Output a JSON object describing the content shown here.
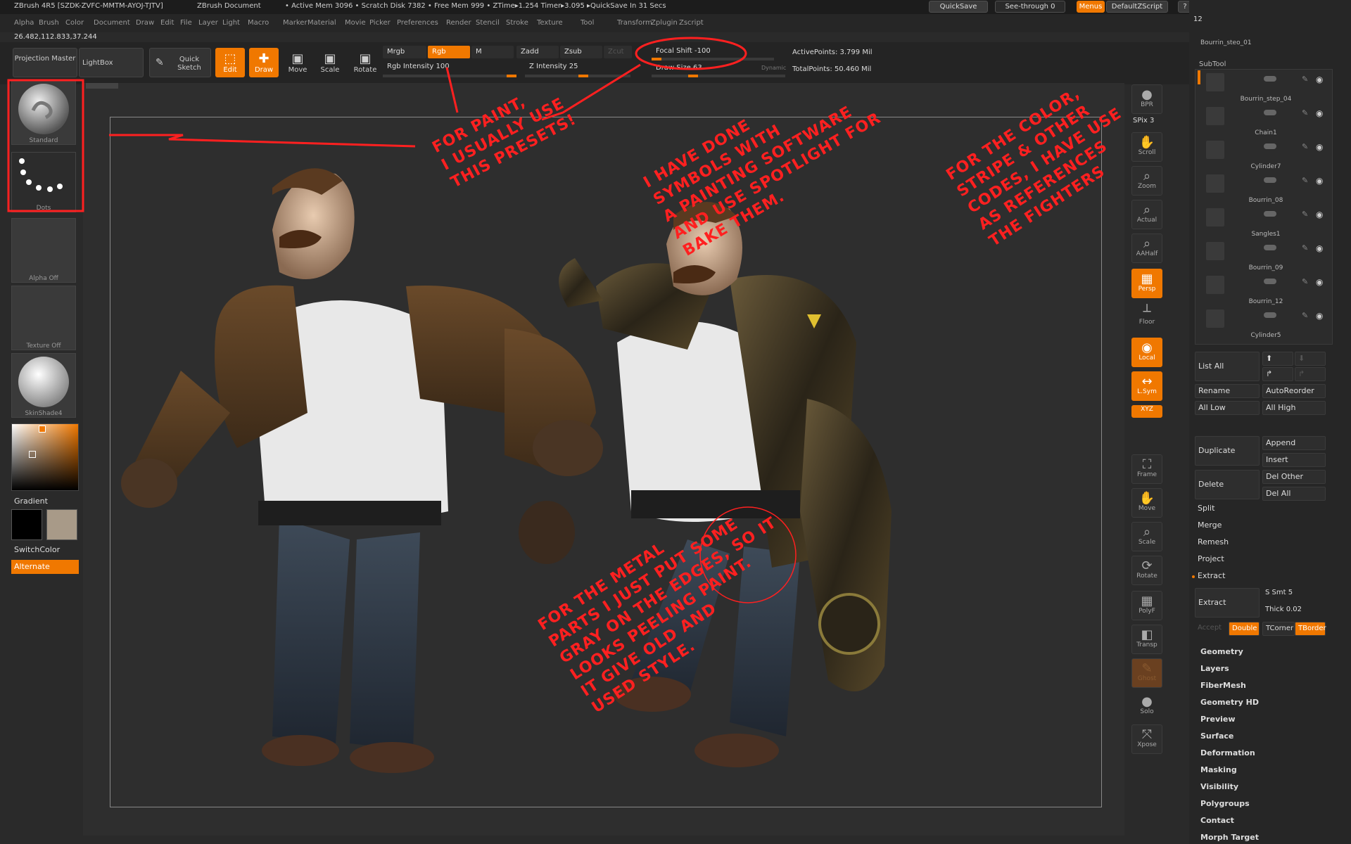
{
  "titlebar": {
    "app": "ZBrush 4R5 [SZDK-ZVFC-MMTM-AYOJ-TJTV]",
    "doc": "ZBrush Document",
    "stats": "• Active Mem 3096 • Scratch Disk 7382 • Free Mem 999 • ZTime▸1.254 Timer▸3.095 ▸QuickSave In 31 Secs",
    "quicksave": "QuickSave",
    "seethrough": "See-through 0",
    "menus": "Menus",
    "script": "DefaultZScript"
  },
  "menubar": [
    "Alpha",
    "Brush",
    "Color",
    "Document",
    "Draw",
    "Edit",
    "File",
    "Layer",
    "Light",
    "Macro",
    "Marker",
    "Material",
    "Movie",
    "Picker",
    "Preferences",
    "Render",
    "Stencil",
    "Stroke",
    "Texture",
    "Tool",
    "Transform",
    "Zplugin",
    "Zscript"
  ],
  "coords": "26.482,112.833,37.244",
  "toolbar": {
    "projection_master": "Projection Master",
    "lightbox": "LightBox",
    "quick_sketch": "Quick Sketch",
    "edit": "Edit",
    "draw": "Draw",
    "move": "Move",
    "scale": "Scale",
    "rotate": "Rotate",
    "mrgb": "Mrgb",
    "rgb": "Rgb",
    "m": "M",
    "zadd": "Zadd",
    "zsub": "Zsub",
    "zcut": "Zcut",
    "rgb_intensity": "Rgb Intensity 100",
    "z_intensity": "Z Intensity 25",
    "focal_shift": "Focal Shift -100",
    "draw_size": "Draw Size 63",
    "dynamic": "Dynamic",
    "active_points": "ActivePoints: 3.799 Mil",
    "total_points": "TotalPoints: 50.460 Mil"
  },
  "leftpanel": {
    "brush": "Standard",
    "stroke": "Dots",
    "alpha": "Alpha Off",
    "texture": "Texture Off",
    "material": "SkinShade4",
    "gradient": "Gradient",
    "switchcolor": "SwitchColor",
    "alternate": "Alternate",
    "main_color": "#000000",
    "secondary_color": "#a89a88"
  },
  "rightbar": {
    "bpr": "BPR",
    "spix": "SPix 3",
    "scroll": "Scroll",
    "zoom": "Zoom",
    "actual": "Actual",
    "aahalf": "AAHalf",
    "persp": "Persp",
    "floor": "Floor",
    "local": "Local",
    "lsym": "L.Sym",
    "xyz": "XYZ",
    "frame": "Frame",
    "move": "Move",
    "scale": "Scale",
    "rotate": "Rotate",
    "polyf": "PolyF",
    "transp": "Transp",
    "ghost": "Ghost",
    "solo": "Solo",
    "xpose": "Xpose"
  },
  "subtool": {
    "top_count": "12",
    "top_name": "Bourrin_steo_01",
    "header": "SubTool",
    "items": [
      "Bourrin_step_04",
      "Chain1",
      "Cylinder7",
      "Bourrin_08",
      "Sangles1",
      "Bourrin_09",
      "Bourrin_12",
      "Cylinder5"
    ],
    "list_all": "List All",
    "rename": "Rename",
    "autoreorder": "AutoReorder",
    "all_low": "All Low",
    "all_high": "All High",
    "duplicate": "Duplicate",
    "append": "Append",
    "insert": "Insert",
    "delete": "Delete",
    "del_other": "Del Other",
    "del_all": "Del All",
    "split": "Split",
    "merge": "Merge",
    "remesh": "Remesh",
    "project": "Project",
    "extract_header": "Extract",
    "extract_btn": "Extract",
    "s_smt": "S Smt 5",
    "thick": "Thick 0.02",
    "accept": "Accept",
    "double": "Double",
    "tcorner": "TCorner",
    "tborder": "TBorder",
    "menus": [
      "Geometry",
      "Layers",
      "FiberMesh",
      "Geometry HD",
      "Preview",
      "Surface",
      "Deformation",
      "Masking",
      "Visibility",
      "Polygroups",
      "Contact",
      "Morph Target"
    ]
  },
  "annotations": {
    "presets": "FOR PAINT,\nI USUALLY USE\nTHIS PRESETS!",
    "symbols": "I HAVE DONE\nSYMBOLS WITH\nA PAINTING SOFTWARE\nAND USE SPOTLIGHT FOR\nBAKE THEM.",
    "colors": "FOR THE COLOR,\nSTRIPE & OTHER\nCODES, I HAVE USE\nAS REFERENCES\nTHE FIGHTERS",
    "metal": "FOR THE METAL\nPARTS I JUST PUT SOME\nGRAY ON THE EDGES, SO IT\nLOOKS PEELING PAINT.\nIT GIVE OLD AND\nUSED STYLE."
  }
}
